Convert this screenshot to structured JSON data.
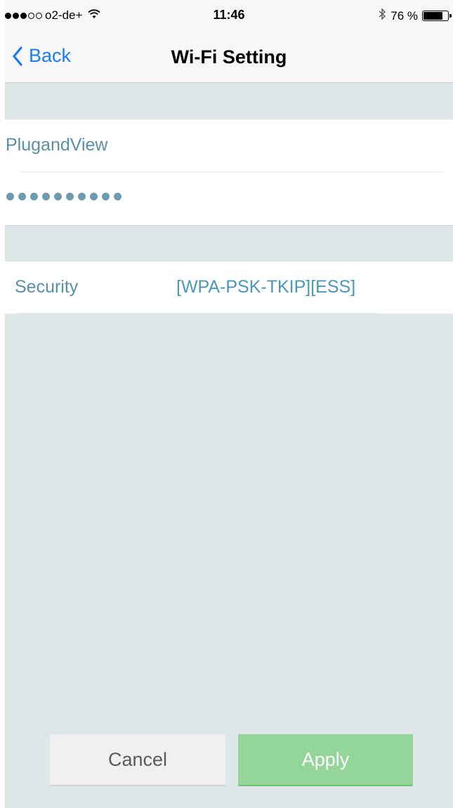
{
  "status_bar": {
    "carrier": "o2-de+",
    "time": "11:46",
    "battery": "76 %",
    "battery_level": 0.76,
    "icons": [
      "signal-dots-icon",
      "wifi-icon",
      "bluetooth-icon",
      "battery-icon"
    ]
  },
  "nav": {
    "back_label": "Back",
    "title": "Wi-Fi Setting"
  },
  "network": {
    "ssid": "PlugandView",
    "password_mask_count": 10
  },
  "security": {
    "label": "Security",
    "value": "[WPA-PSK-TKIP][ESS]"
  },
  "buttons": {
    "cancel": "Cancel",
    "apply": "Apply"
  },
  "colors": {
    "accent_blue": "#1a7cf2",
    "text_teal": "#5b8fa6",
    "apply_green": "#94d59a",
    "background": "#dfe6e7"
  }
}
